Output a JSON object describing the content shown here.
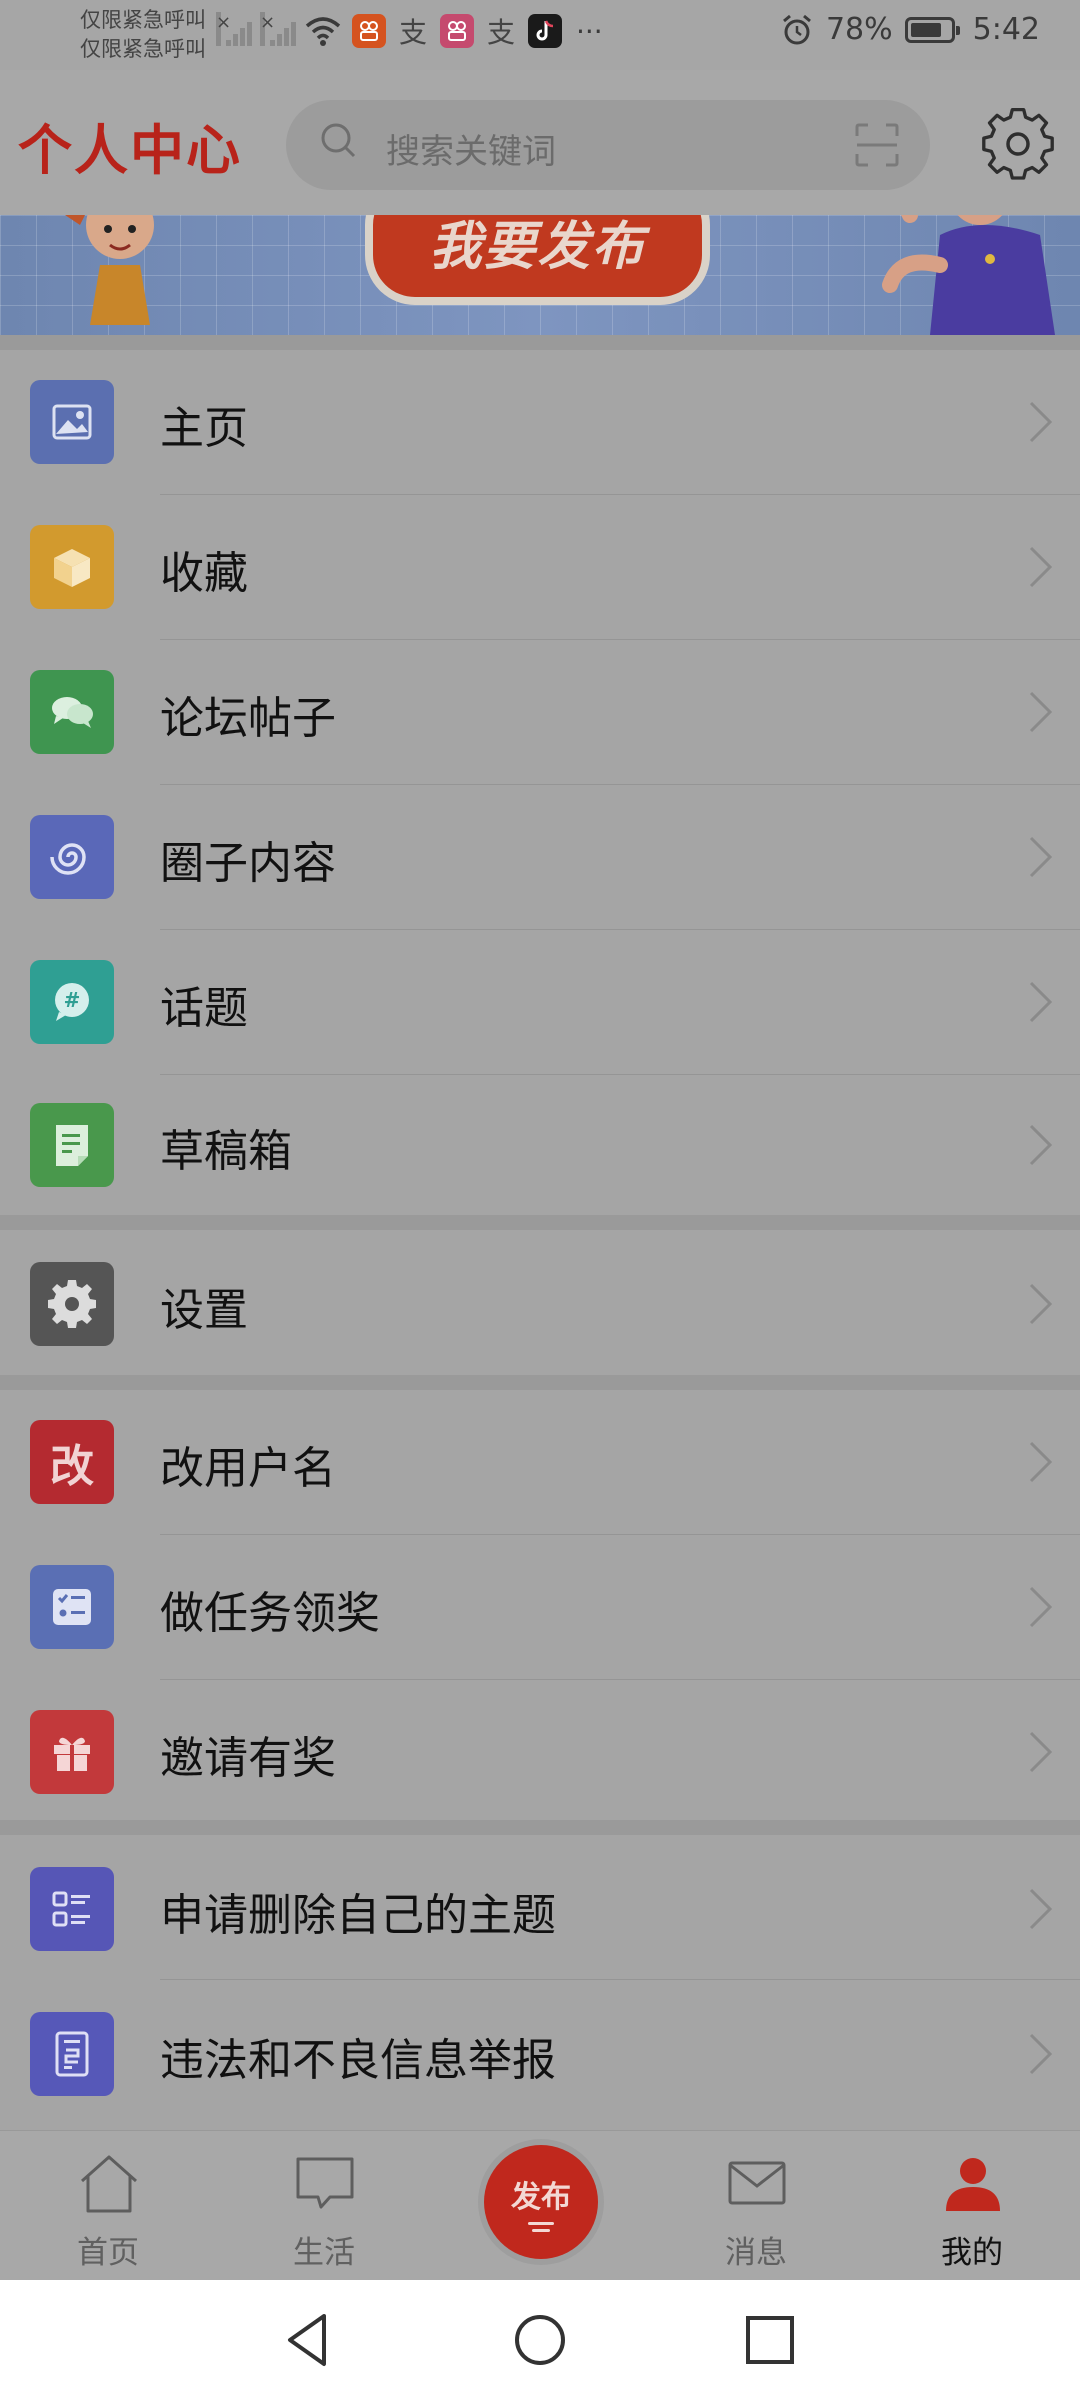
{
  "status_bar": {
    "carrier_line1": "仅限紧急呼叫",
    "carrier_line2": "仅限紧急呼叫",
    "ali_glyph": "支",
    "more": "···",
    "battery": "78%",
    "battery_level": 0.78,
    "time": "5:42"
  },
  "header": {
    "title": "个人中心",
    "search_placeholder": "搜索关键词"
  },
  "banner": {
    "button_text": "我要发布"
  },
  "menu_groups": [
    [
      {
        "label": "主页",
        "icon": "image-icon",
        "color": "#5b6fb0"
      },
      {
        "label": "收藏",
        "icon": "box-icon",
        "color": "#d29a2e"
      },
      {
        "label": "论坛帖子",
        "icon": "chat-bubbles-icon",
        "color": "#3f9550"
      },
      {
        "label": "圈子内容",
        "icon": "swirl-icon",
        "color": "#5a68b8"
      },
      {
        "label": "话题",
        "icon": "hashtag-bubble-icon",
        "color": "#2f9f93"
      },
      {
        "label": "草稿箱",
        "icon": "draft-document-icon",
        "color": "#49984c"
      }
    ],
    [
      {
        "label": "设置",
        "icon": "gear-icon",
        "color": "#555555"
      }
    ],
    [
      {
        "label": "改用户名",
        "icon": "rename-icon",
        "icon_text": "改",
        "color": "#b42a30"
      },
      {
        "label": "做任务领奖",
        "icon": "task-list-icon",
        "color": "#5a6fb4"
      },
      {
        "label": "邀请有奖",
        "icon": "gift-icon",
        "color": "#c2393b"
      }
    ],
    [
      {
        "label": "申请删除自己的主题",
        "icon": "list-delete-icon",
        "color": "#5656b6"
      },
      {
        "label": "违法和不良信息举报",
        "icon": "report-icon",
        "color": "#5658b8"
      }
    ]
  ],
  "bottom_nav": {
    "home": "首页",
    "life": "生活",
    "publish": "发布",
    "messages": "消息",
    "mine": "我的"
  },
  "colors": {
    "brand_red": "#c0281d",
    "dim_background": "#a8a8a8"
  }
}
